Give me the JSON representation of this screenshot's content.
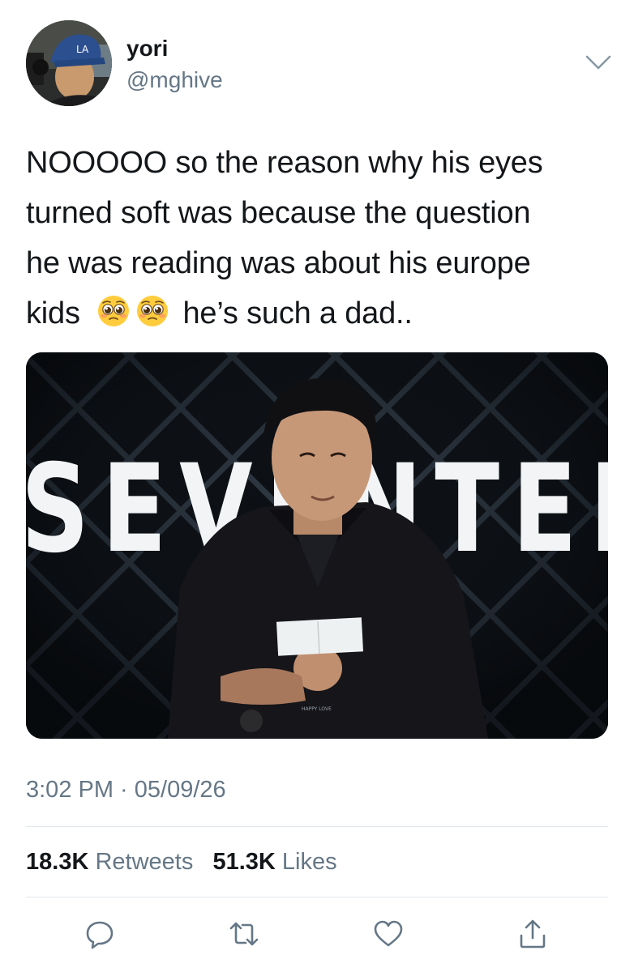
{
  "author": {
    "name": "yori",
    "handle": "@mghive"
  },
  "tweet": {
    "text_lines": [
      "NOOOOO so the reason why his eyes",
      "turned soft was because the question",
      "he was reading was about his europe",
      "kids",
      "he’s such a dad.."
    ],
    "emoji": "pleading-face-emoji",
    "image": {
      "banner_text": "SEVENTEEN",
      "card_text": "HAPPY LOVE"
    }
  },
  "meta": {
    "timestamp": "3:02 PM · 05/09/26"
  },
  "stats": {
    "retweets_count": "18.3K",
    "retweets_label": "Retweets",
    "likes_count": "51.3K",
    "likes_label": "Likes"
  },
  "actions": [
    "reply-icon",
    "retweet-icon",
    "like-icon",
    "share-icon"
  ],
  "colors": {
    "text": "#14171a",
    "secondary": "#657786",
    "divider": "#e1e8ed"
  }
}
